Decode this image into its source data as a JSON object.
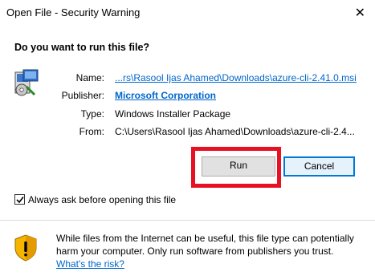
{
  "window": {
    "title": "Open File - Security Warning",
    "close_glyph": "✕"
  },
  "question": "Do you want to run this file?",
  "details": {
    "name_label": "Name:",
    "name_value": "...rs\\Rasool Ijas Ahamed\\Downloads\\azure-cli-2.41.0.msi",
    "publisher_label": "Publisher:",
    "publisher_value": "Microsoft Corporation",
    "type_label": "Type:",
    "type_value": "Windows Installer Package",
    "from_label": "From:",
    "from_value": "C:\\Users\\Rasool Ijas Ahamed\\Downloads\\azure-cli-2.4..."
  },
  "buttons": {
    "run": "Run",
    "cancel": "Cancel"
  },
  "always_ask": {
    "label": "Always ask before opening this file",
    "checked": true
  },
  "warning": {
    "text": "While files from the Internet can be useful, this file type can potentially harm your computer. Only run software from publishers you trust.",
    "link": "What's the risk?"
  },
  "icons": {
    "file": "installer-package-icon",
    "shield": "security-shield-icon"
  },
  "colors": {
    "link": "#0066cc",
    "highlight": "#e81123",
    "focus": "#0078d7"
  }
}
